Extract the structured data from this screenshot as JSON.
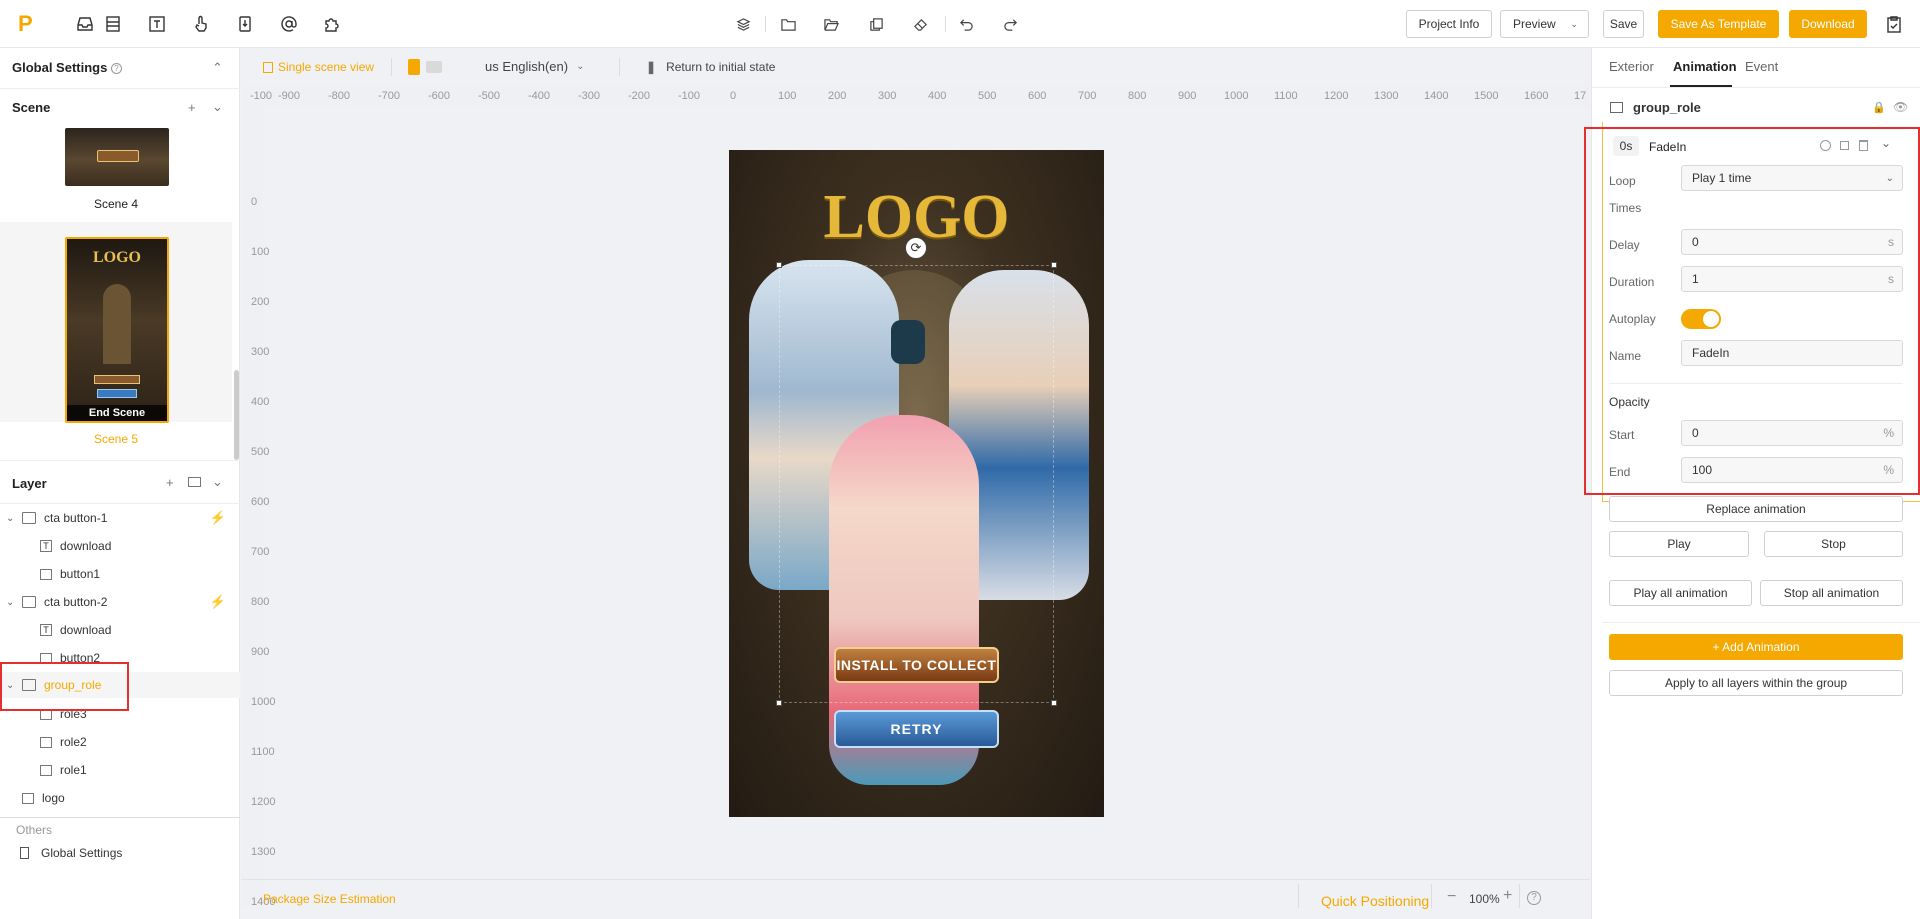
{
  "toolbar": {
    "logo_letter": "P",
    "project_info": "Project Info",
    "preview": "Preview",
    "save": "Save",
    "save_template": "Save As Template",
    "download": "Download"
  },
  "left": {
    "global_settings": "Global Settings",
    "scene_title": "Scene",
    "scenes": [
      {
        "label": "Scene 4"
      },
      {
        "label": "Scene 5",
        "overlay": "End Scene",
        "thumb_logo": "LOGO"
      }
    ],
    "layer_title": "Layer",
    "layers": [
      {
        "label": "cta button-1"
      },
      {
        "label": "download"
      },
      {
        "label": "button1"
      },
      {
        "label": "cta button-2"
      },
      {
        "label": "download"
      },
      {
        "label": "button2"
      },
      {
        "label": "group_role"
      },
      {
        "label": "role3"
      },
      {
        "label": "role2"
      },
      {
        "label": "role1"
      },
      {
        "label": "logo"
      }
    ],
    "others_label": "Others",
    "others_global": "Global Settings"
  },
  "canvas": {
    "single_scene_view": "Single scene view",
    "language": "us English(en)",
    "return_initial": "Return to initial state",
    "ruler_h": [
      "-100",
      "-900",
      "-800",
      "-700",
      "-600",
      "-500",
      "-400",
      "-300",
      "-200",
      "-100",
      "0",
      "100",
      "200",
      "300",
      "400",
      "500",
      "600",
      "700",
      "800",
      "900",
      "1000",
      "1100",
      "1200",
      "1300",
      "1400",
      "1500",
      "1600",
      "17"
    ],
    "ruler_v": [
      "0",
      "100",
      "200",
      "300",
      "400",
      "500",
      "600",
      "700",
      "800",
      "900",
      "1000",
      "1100",
      "1200",
      "1300",
      "1400"
    ],
    "phone": {
      "logo": "LOGO",
      "install": "INSTALL TO COLLECT",
      "retry": "RETRY"
    },
    "package_size": "Package Size Estimation",
    "quick_positioning": "Quick Positioning",
    "zoom": "100%"
  },
  "right": {
    "tabs": [
      "Exterior",
      "Animation",
      "Event"
    ],
    "group_name": "group_role",
    "anim_time": "0s",
    "anim_name": "FadeIn",
    "loop_label": "Loop",
    "times_label": "Times",
    "loop_value": "Play 1 time",
    "delay_label": "Delay",
    "delay_value": "0",
    "duration_label": "Duration",
    "duration_value": "1",
    "unit_s": "s",
    "autoplay_label": "Autoplay",
    "autoplay_on": true,
    "name_label": "Name",
    "name_value": "FadeIn",
    "opacity_label": "Opacity",
    "start_label": "Start",
    "start_value": "0",
    "end_label": "End",
    "end_value": "100",
    "unit_pct": "%",
    "replace": "Replace animation",
    "play": "Play",
    "stop": "Stop",
    "play_all": "Play all animation",
    "stop_all": "Stop all animation",
    "add_animation": "+ Add Animation",
    "apply_all": "Apply to all layers within the group"
  },
  "colors": {
    "accent": "#f5a800",
    "highlight": "#e3302f"
  }
}
